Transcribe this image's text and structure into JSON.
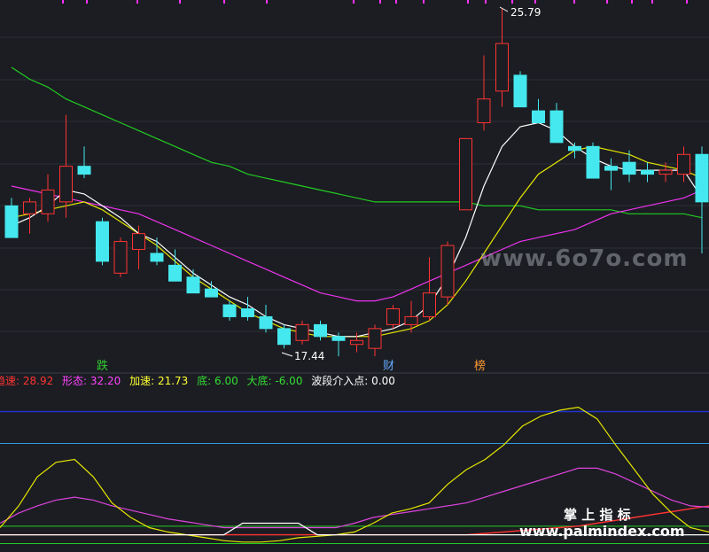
{
  "watermark": {
    "text": "www.6o7o.com"
  },
  "brand": {
    "cn": "掌 上 指 标",
    "url": "www.palmindex.com"
  },
  "price_labels": {
    "high": "25.79",
    "low": "17.44"
  },
  "signals": [
    {
      "text": "跌",
      "color": "#33cc33"
    },
    {
      "text": "财",
      "color": "#66aaff"
    },
    {
      "text": "榜",
      "color": "#ff9933"
    }
  ],
  "indicator_legend": [
    {
      "text": "趋速: 28.92",
      "color": "#ff3333"
    },
    {
      "text": "形态: 32.20",
      "color": "#ff44ff"
    },
    {
      "text": "加速: 21.73",
      "color": "#ffff33"
    },
    {
      "text": "底: 6.00",
      "color": "#33dd33"
    },
    {
      "text": "大底: -6.00",
      "color": "#33dd33"
    },
    {
      "text": "波段介入点: 0.00",
      "color": "#ffffff"
    }
  ],
  "colors": {
    "up": "#ff3333",
    "down": "#44e8ee",
    "ma_white": "#ffffff",
    "ma_yellow": "#e6e600",
    "ma_magenta": "#ee33ee",
    "ma_green": "#22cc22",
    "grid": "#2c3038",
    "tick": "#ff33ff"
  },
  "chart_data": {
    "type": "candlestick",
    "y_range": [
      16.6,
      26.0
    ],
    "high": 25.79,
    "low": 17.44,
    "candles": [
      {
        "o": 20.8,
        "h": 21.0,
        "l": 20.0,
        "c": 20.0
      },
      {
        "o": 20.6,
        "h": 21.0,
        "l": 20.1,
        "c": 20.9
      },
      {
        "o": 20.6,
        "h": 21.6,
        "l": 20.4,
        "c": 21.2
      },
      {
        "o": 20.9,
        "h": 23.1,
        "l": 20.5,
        "c": 21.8
      },
      {
        "o": 21.8,
        "h": 22.3,
        "l": 21.5,
        "c": 21.6
      },
      {
        "o": 20.4,
        "h": 20.5,
        "l": 19.3,
        "c": 19.4
      },
      {
        "o": 19.1,
        "h": 20.0,
        "l": 19.0,
        "c": 19.9
      },
      {
        "o": 19.7,
        "h": 20.3,
        "l": 19.2,
        "c": 20.1
      },
      {
        "o": 19.6,
        "h": 20.0,
        "l": 19.3,
        "c": 19.4
      },
      {
        "o": 19.3,
        "h": 19.7,
        "l": 18.9,
        "c": 18.9
      },
      {
        "o": 19.0,
        "h": 19.2,
        "l": 18.6,
        "c": 18.6
      },
      {
        "o": 18.7,
        "h": 18.9,
        "l": 18.5,
        "c": 18.5
      },
      {
        "o": 18.3,
        "h": 18.4,
        "l": 17.9,
        "c": 18.0
      },
      {
        "o": 18.2,
        "h": 18.5,
        "l": 17.9,
        "c": 18.0
      },
      {
        "o": 18.0,
        "h": 18.3,
        "l": 17.6,
        "c": 17.7
      },
      {
        "o": 17.7,
        "h": 17.8,
        "l": 17.2,
        "c": 17.3
      },
      {
        "o": 17.4,
        "h": 17.9,
        "l": 17.3,
        "c": 17.8
      },
      {
        "o": 17.8,
        "h": 17.9,
        "l": 17.4,
        "c": 17.5
      },
      {
        "o": 17.5,
        "h": 17.6,
        "l": 17.0,
        "c": 17.4
      },
      {
        "o": 17.3,
        "h": 17.6,
        "l": 17.1,
        "c": 17.4
      },
      {
        "o": 17.2,
        "h": 17.8,
        "l": 17.0,
        "c": 17.7
      },
      {
        "o": 17.8,
        "h": 18.3,
        "l": 17.7,
        "c": 18.2
      },
      {
        "o": 17.8,
        "h": 18.4,
        "l": 17.6,
        "c": 18.0
      },
      {
        "o": 18.0,
        "h": 19.5,
        "l": 17.9,
        "c": 18.6
      },
      {
        "o": 18.5,
        "h": 19.9,
        "l": 18.3,
        "c": 19.8
      },
      {
        "o": 20.7,
        "h": 22.1,
        "l": 20.7,
        "c": 22.5
      },
      {
        "o": 22.9,
        "h": 24.6,
        "l": 22.7,
        "c": 23.5
      },
      {
        "o": 23.7,
        "h": 25.79,
        "l": 23.3,
        "c": 24.9
      },
      {
        "o": 24.1,
        "h": 24.2,
        "l": 23.3,
        "c": 23.3
      },
      {
        "o": 23.2,
        "h": 23.5,
        "l": 22.9,
        "c": 22.9
      },
      {
        "o": 23.2,
        "h": 23.4,
        "l": 22.4,
        "c": 22.4
      },
      {
        "o": 22.3,
        "h": 22.4,
        "l": 22.0,
        "c": 22.2
      },
      {
        "o": 22.3,
        "h": 22.4,
        "l": 21.5,
        "c": 21.5
      },
      {
        "o": 21.8,
        "h": 22.0,
        "l": 21.2,
        "c": 21.7
      },
      {
        "o": 21.9,
        "h": 22.2,
        "l": 21.4,
        "c": 21.6
      },
      {
        "o": 21.7,
        "h": 21.9,
        "l": 21.4,
        "c": 21.6
      },
      {
        "o": 21.6,
        "h": 21.9,
        "l": 21.4,
        "c": 21.7
      },
      {
        "o": 21.6,
        "h": 22.3,
        "l": 21.4,
        "c": 22.1
      },
      {
        "o": 22.1,
        "h": 22.3,
        "l": 19.6,
        "c": 20.9
      }
    ],
    "ma_white": [
      20.3,
      20.5,
      20.8,
      21.2,
      21.1,
      20.8,
      20.5,
      20.1,
      19.9,
      19.5,
      19.1,
      18.8,
      18.5,
      18.3,
      18.0,
      17.8,
      17.7,
      17.6,
      17.5,
      17.5,
      17.6,
      17.7,
      17.9,
      18.3,
      19.0,
      20.0,
      21.3,
      22.3,
      22.8,
      22.9,
      22.7,
      22.3,
      22.0,
      21.8,
      21.7,
      21.7,
      21.7,
      21.7,
      21.0
    ],
    "ma_yellow": [
      20.5,
      20.6,
      20.7,
      20.8,
      20.9,
      20.7,
      20.4,
      20.1,
      19.8,
      19.4,
      19.0,
      18.7,
      18.4,
      18.1,
      17.9,
      17.7,
      17.6,
      17.5,
      17.5,
      17.5,
      17.5,
      17.6,
      17.7,
      17.9,
      18.3,
      18.9,
      19.6,
      20.3,
      21.0,
      21.6,
      21.9,
      22.2,
      22.3,
      22.2,
      22.1,
      21.9,
      21.8,
      21.7,
      21.5
    ],
    "ma_magenta": [
      21.3,
      21.2,
      21.1,
      21.0,
      20.9,
      20.8,
      20.7,
      20.6,
      20.4,
      20.2,
      20.0,
      19.8,
      19.6,
      19.4,
      19.2,
      19.0,
      18.8,
      18.6,
      18.5,
      18.4,
      18.4,
      18.5,
      18.7,
      18.9,
      19.1,
      19.3,
      19.5,
      19.7,
      19.9,
      20.0,
      20.1,
      20.2,
      20.4,
      20.6,
      20.7,
      20.8,
      20.9,
      21.0,
      21.2
    ],
    "ma_green": [
      24.3,
      24.0,
      23.8,
      23.5,
      23.3,
      23.1,
      22.9,
      22.7,
      22.5,
      22.3,
      22.1,
      21.9,
      21.8,
      21.6,
      21.5,
      21.4,
      21.3,
      21.2,
      21.1,
      21.0,
      20.9,
      20.9,
      20.9,
      20.9,
      20.9,
      20.9,
      20.8,
      20.8,
      20.8,
      20.7,
      20.7,
      20.7,
      20.7,
      20.7,
      20.6,
      20.6,
      20.6,
      20.6,
      20.5
    ],
    "indicator": {
      "y_range": [
        -10,
        100
      ],
      "levels": [
        85,
        63
      ],
      "accel_yellow": [
        5,
        20,
        40,
        50,
        52,
        40,
        22,
        12,
        5,
        2,
        0,
        -2,
        -4,
        -5,
        -5,
        -4,
        -2,
        -1,
        0,
        2,
        8,
        15,
        18,
        22,
        35,
        45,
        52,
        62,
        75,
        82,
        86,
        88,
        80,
        62,
        45,
        28,
        15,
        5,
        2
      ],
      "shape_magenta": [
        8,
        15,
        20,
        24,
        26,
        24,
        20,
        17,
        14,
        11,
        9,
        7,
        5,
        5,
        5,
        5,
        5,
        5,
        5,
        8,
        12,
        14,
        16,
        18,
        20,
        22,
        26,
        30,
        34,
        38,
        42,
        46,
        46,
        42,
        36,
        30,
        24,
        20,
        19
      ],
      "trend_red": [
        0,
        0,
        0,
        0,
        0,
        0,
        0,
        0,
        0,
        0,
        0,
        0,
        0,
        0,
        0,
        0,
        0,
        0,
        0,
        0,
        0,
        0,
        0,
        0,
        0,
        0,
        1,
        2,
        3,
        4,
        5,
        6,
        8,
        10,
        12,
        14,
        16,
        18,
        20
      ],
      "band_white": [
        0,
        0,
        0,
        0,
        0,
        0,
        0,
        0,
        0,
        0,
        0,
        0,
        0,
        1,
        1,
        1,
        1,
        0,
        0,
        0,
        0,
        0,
        0,
        0,
        0,
        0,
        0,
        0,
        0,
        0,
        0,
        0,
        0,
        0,
        0,
        0,
        0,
        0,
        0
      ],
      "bottom_green": 6.0,
      "big_bottom_green": -6.0
    }
  }
}
